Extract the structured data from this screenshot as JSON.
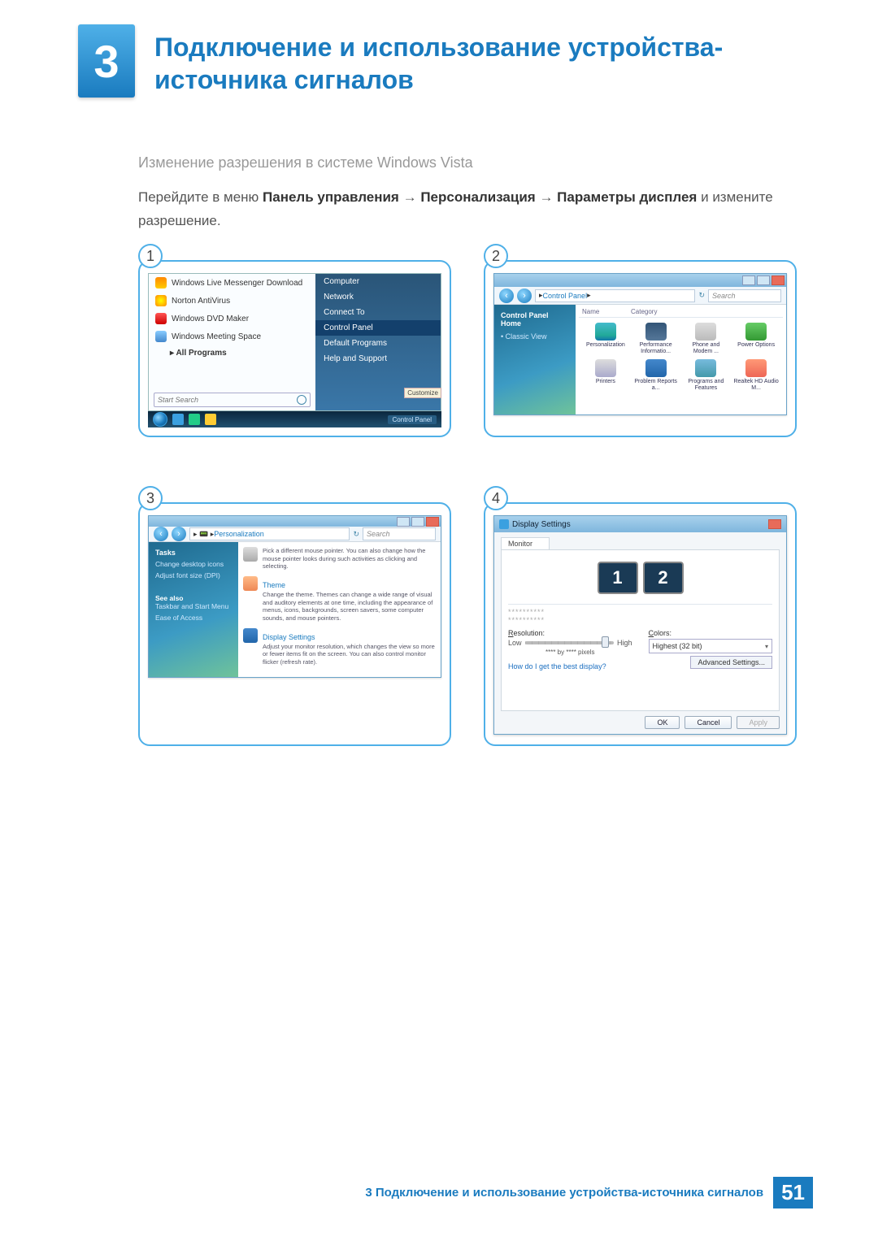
{
  "chapter": {
    "number": "3",
    "title": "Подключение и использование устройства-источника сигналов"
  },
  "subheading": "Изменение разрешения в системе Windows Vista",
  "instruction": {
    "pre": "Перейдите в меню ",
    "b1": "Панель управления",
    "arrow": " → ",
    "b2": "Персонализация",
    "b3": "Параметры дисплея",
    "post": " и измените разрешение."
  },
  "fig_numbers": [
    "1",
    "2",
    "3",
    "4"
  ],
  "fig1": {
    "left_items": [
      "Windows Live Messenger Download",
      "Norton AntiVirus",
      "Windows DVD Maker",
      "Windows Meeting Space"
    ],
    "all_programs": "All Programs",
    "search_placeholder": "Start Search",
    "right_items": [
      "Computer",
      "Network",
      "Connect To",
      "Control Panel",
      "Default Programs",
      "Help and Support"
    ],
    "right_highlight_index": 3,
    "customize_tooltip": "Customize",
    "taskbar_task": "Control Panel"
  },
  "fig2": {
    "breadcrumb": "Control Panel",
    "search_placeholder": "Search",
    "side_links": {
      "home": "Control Panel Home",
      "classic": "Classic View"
    },
    "columns": [
      "Name",
      "Category"
    ],
    "icons": [
      {
        "label": "Personalization",
        "cls": "g-pers"
      },
      {
        "label": "Performance Informatio...",
        "cls": "g-perf"
      },
      {
        "label": "Phone and Modem ...",
        "cls": "g-phone"
      },
      {
        "label": "Power Options",
        "cls": "g-power"
      },
      {
        "label": "Printers",
        "cls": "g-print"
      },
      {
        "label": "Problem Reports a...",
        "cls": "g-prob"
      },
      {
        "label": "Programs and Features",
        "cls": "g-prog"
      },
      {
        "label": "Realtek HD Audio M...",
        "cls": "g-realtek"
      }
    ]
  },
  "fig3": {
    "breadcrumb": "Personalization",
    "search_placeholder": "Search",
    "side": {
      "tasks": "Tasks",
      "links": [
        "Change desktop icons",
        "Adjust font size (DPI)"
      ],
      "see_also": "See also",
      "see_links": [
        "Taskbar and Start Menu",
        "Ease of Access"
      ]
    },
    "items": [
      {
        "title": "",
        "desc": "Pick a different mouse pointer. You can also change how the mouse pointer looks during such activities as clicking and selecting.",
        "cls": "p-mouse"
      },
      {
        "title": "Theme",
        "desc": "Change the theme. Themes can change a wide range of visual and auditory elements at one time, including the appearance of menus, icons, backgrounds, screen savers, some computer sounds, and mouse pointers.",
        "cls": "p-theme"
      },
      {
        "title": "Display Settings",
        "desc": "Adjust your monitor resolution, which changes the view so more or fewer items fit on the screen. You can also control monitor flicker (refresh rate).",
        "cls": "p-disp"
      }
    ]
  },
  "fig4": {
    "title": "Display Settings",
    "tab": "Monitor",
    "monitor_numbers": [
      "1",
      "2"
    ],
    "placeholder_lines": "**********",
    "resolution_label": "Resolution:",
    "low": "Low",
    "high": "High",
    "res_value": "**** by **** pixels",
    "colors_label": "Colors:",
    "colors_value": "Highest (32 bit)",
    "help_link": "How do I get the best display?",
    "advanced": "Advanced Settings...",
    "buttons": {
      "ok": "OK",
      "cancel": "Cancel",
      "apply": "Apply"
    }
  },
  "footer": {
    "text": "3 Подключение и использование устройства-источника сигналов",
    "page": "51"
  }
}
